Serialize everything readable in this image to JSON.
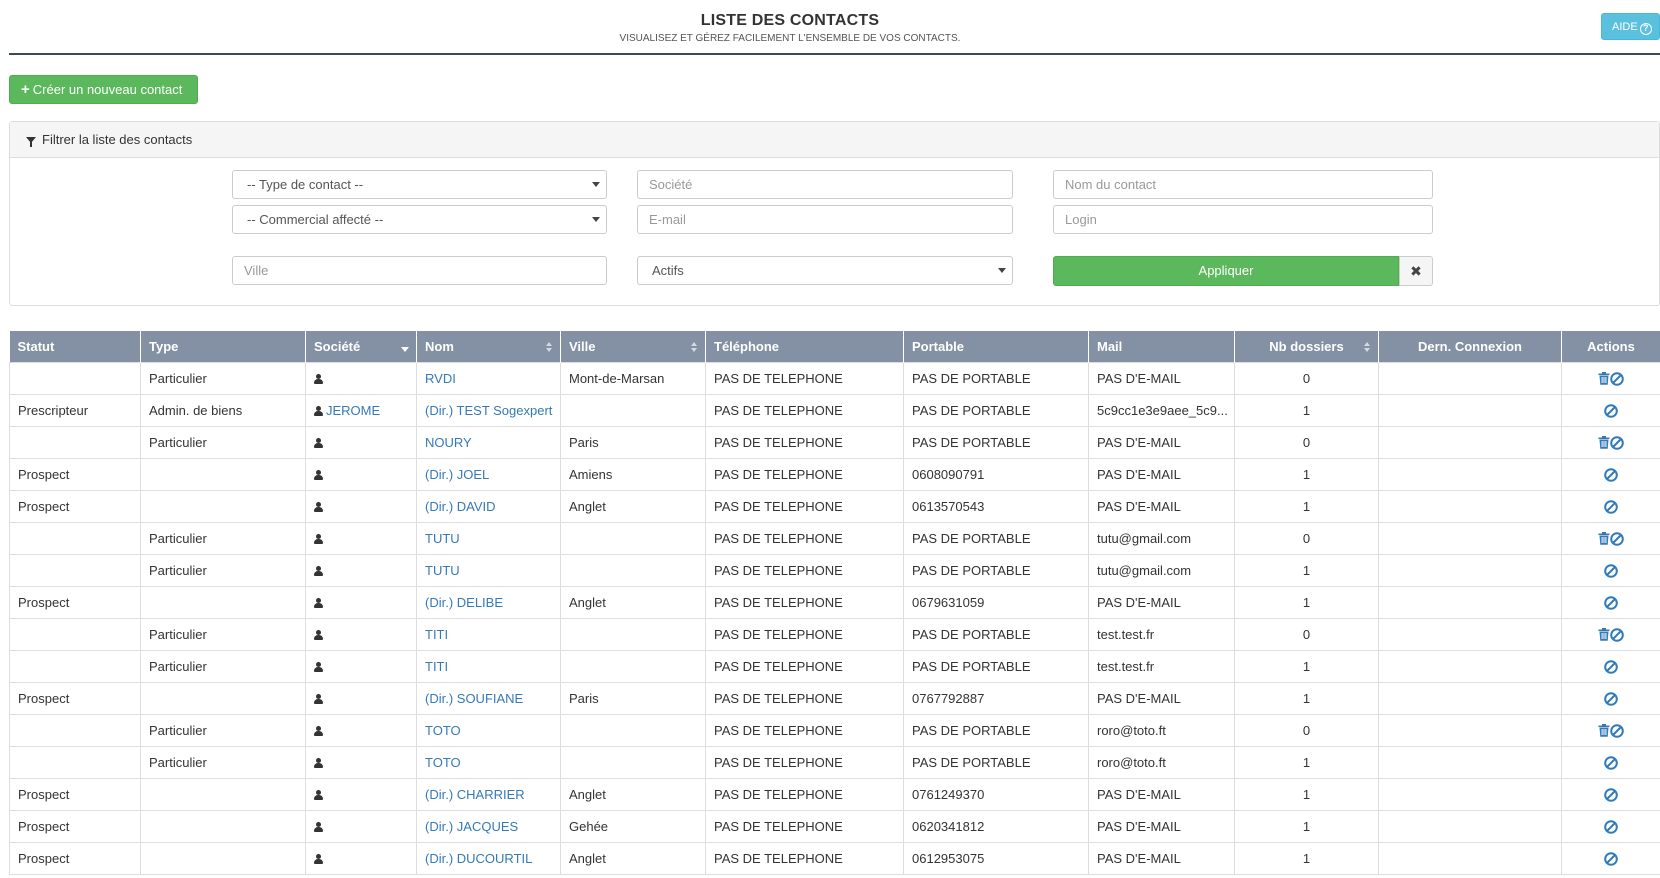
{
  "header": {
    "title": "LISTE DES CONTACTS",
    "subtitle": "VISUALISEZ ET GÉREZ FACILEMENT L'ENSEMBLE DE VOS CONTACTS.",
    "help_label": "AIDE"
  },
  "toolbar": {
    "create_label": "Créer un nouveau contact"
  },
  "filter": {
    "title": "Filtrer la liste des contacts",
    "type_contact": "-- Type de contact --",
    "commercial": "-- Commercial affecté --",
    "ville_placeholder": "Ville",
    "societe_placeholder": "Société",
    "email_placeholder": "E-mail",
    "statut_value": "Actifs",
    "nom_placeholder": "Nom du contact",
    "login_placeholder": "Login",
    "apply_label": "Appliquer",
    "clear_label": "✖"
  },
  "table": {
    "columns": [
      "Statut",
      "Type",
      "Société",
      "Nom",
      "Ville",
      "Téléphone",
      "Portable",
      "Mail",
      "Nb dossiers",
      "Dern. Connexion",
      "Actions"
    ],
    "rows": [
      {
        "statut": "",
        "type": "Particulier",
        "societe": "",
        "nom": "RVDI",
        "ville": "Mont-de-Marsan",
        "telephone": "PAS DE TELEPHONE",
        "portable": "PAS DE PORTABLE",
        "mail": "PAS D'E-MAIL",
        "nb": "0",
        "connexion": "",
        "delete": true
      },
      {
        "statut": "Prescripteur",
        "type": "Admin. de biens",
        "societe": "JEROME",
        "nom": "(Dir.) TEST Sogexpert",
        "ville": "",
        "telephone": "PAS DE TELEPHONE",
        "portable": "PAS DE PORTABLE",
        "mail": "5c9cc1e3e9aee_5c9...",
        "nb": "1",
        "connexion": "",
        "delete": false
      },
      {
        "statut": "",
        "type": "Particulier",
        "societe": "",
        "nom": "NOURY",
        "ville": "Paris",
        "telephone": "PAS DE TELEPHONE",
        "portable": "PAS DE PORTABLE",
        "mail": "PAS D'E-MAIL",
        "nb": "0",
        "connexion": "",
        "delete": true
      },
      {
        "statut": "Prospect",
        "type": "",
        "societe": "",
        "nom": "(Dir.) JOEL",
        "ville": "Amiens",
        "telephone": "PAS DE TELEPHONE",
        "portable": "0608090791",
        "mail": "PAS D'E-MAIL",
        "nb": "1",
        "connexion": "",
        "delete": false
      },
      {
        "statut": "Prospect",
        "type": "",
        "societe": "",
        "nom": "(Dir.) DAVID",
        "ville": "Anglet",
        "telephone": "PAS DE TELEPHONE",
        "portable": "0613570543",
        "mail": "PAS D'E-MAIL",
        "nb": "1",
        "connexion": "",
        "delete": false
      },
      {
        "statut": "",
        "type": "Particulier",
        "societe": "",
        "nom": "TUTU",
        "ville": "",
        "telephone": "PAS DE TELEPHONE",
        "portable": "PAS DE PORTABLE",
        "mail": "tutu@gmail.com",
        "nb": "0",
        "connexion": "",
        "delete": true
      },
      {
        "statut": "",
        "type": "Particulier",
        "societe": "",
        "nom": "TUTU",
        "ville": "",
        "telephone": "PAS DE TELEPHONE",
        "portable": "PAS DE PORTABLE",
        "mail": "tutu@gmail.com",
        "nb": "1",
        "connexion": "",
        "delete": false
      },
      {
        "statut": "Prospect",
        "type": "",
        "societe": "",
        "nom": "(Dir.) DELIBE",
        "ville": "Anglet",
        "telephone": "PAS DE TELEPHONE",
        "portable": "0679631059",
        "mail": "PAS D'E-MAIL",
        "nb": "1",
        "connexion": "",
        "delete": false
      },
      {
        "statut": "",
        "type": "Particulier",
        "societe": "",
        "nom": "TITI",
        "ville": "",
        "telephone": "PAS DE TELEPHONE",
        "portable": "PAS DE PORTABLE",
        "mail": "test.test.fr",
        "nb": "0",
        "connexion": "",
        "delete": true
      },
      {
        "statut": "",
        "type": "Particulier",
        "societe": "",
        "nom": "TITI",
        "ville": "",
        "telephone": "PAS DE TELEPHONE",
        "portable": "PAS DE PORTABLE",
        "mail": "test.test.fr",
        "nb": "1",
        "connexion": "",
        "delete": false
      },
      {
        "statut": "Prospect",
        "type": "",
        "societe": "",
        "nom": "(Dir.) SOUFIANE",
        "ville": "Paris",
        "telephone": "PAS DE TELEPHONE",
        "portable": "0767792887",
        "mail": "PAS D'E-MAIL",
        "nb": "1",
        "connexion": "",
        "delete": false
      },
      {
        "statut": "",
        "type": "Particulier",
        "societe": "",
        "nom": "TOTO",
        "ville": "",
        "telephone": "PAS DE TELEPHONE",
        "portable": "PAS DE PORTABLE",
        "mail": "roro@toto.ft",
        "nb": "0",
        "connexion": "",
        "delete": true
      },
      {
        "statut": "",
        "type": "Particulier",
        "societe": "",
        "nom": "TOTO",
        "ville": "",
        "telephone": "PAS DE TELEPHONE",
        "portable": "PAS DE PORTABLE",
        "mail": "roro@toto.ft",
        "nb": "1",
        "connexion": "",
        "delete": false
      },
      {
        "statut": "Prospect",
        "type": "",
        "societe": "",
        "nom": "(Dir.) CHARRIER",
        "ville": "Anglet",
        "telephone": "PAS DE TELEPHONE",
        "portable": "0761249370",
        "mail": "PAS D'E-MAIL",
        "nb": "1",
        "connexion": "",
        "delete": false
      },
      {
        "statut": "Prospect",
        "type": "",
        "societe": "",
        "nom": "(Dir.) JACQUES",
        "ville": "Gehée",
        "telephone": "PAS DE TELEPHONE",
        "portable": "0620341812",
        "mail": "PAS D'E-MAIL",
        "nb": "1",
        "connexion": "",
        "delete": false
      },
      {
        "statut": "Prospect",
        "type": "",
        "societe": "",
        "nom": "(Dir.) DUCOURTIL",
        "ville": "Anglet",
        "telephone": "PAS DE TELEPHONE",
        "portable": "0612953075",
        "mail": "PAS D'E-MAIL",
        "nb": "1",
        "connexion": "",
        "delete": false
      }
    ]
  },
  "colors": {
    "accent_green": "#5cb85c",
    "info_blue": "#5bc0de",
    "header_gray": "#8490a4",
    "link_blue": "#337ab7",
    "warning_red": "#e31b1b"
  }
}
